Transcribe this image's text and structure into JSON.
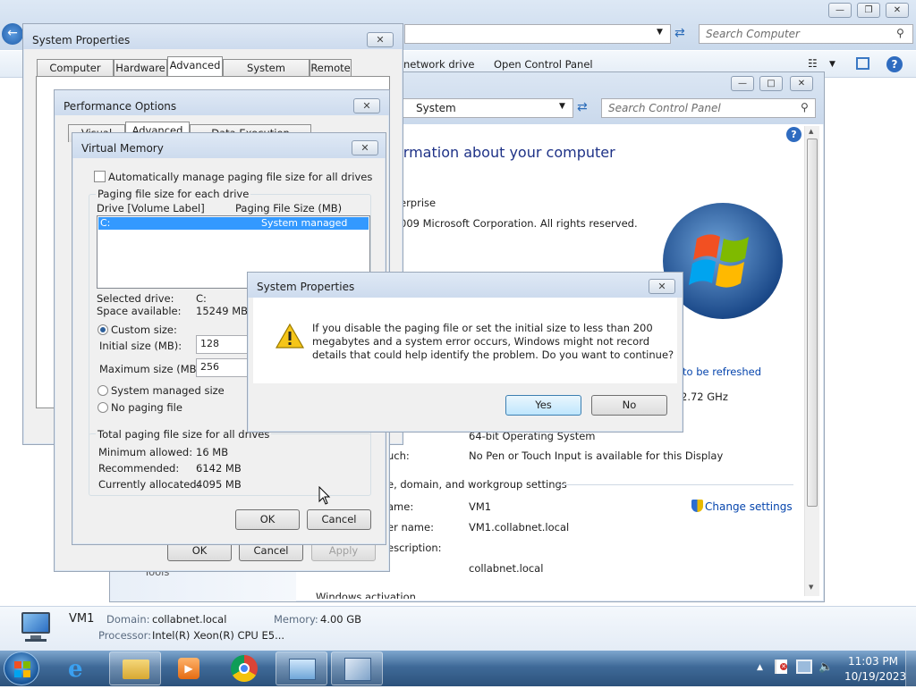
{
  "explorer": {
    "search_placeholder": "Search Computer",
    "toolbar_items": [
      "network drive",
      "Open Control Panel"
    ]
  },
  "control_panel": {
    "breadcrumb": "System",
    "search_placeholder": "Search Control Panel",
    "heading": "ormation about your computer",
    "edition_text": "erprise",
    "copyright_text": "009 Microsoft Corporation.  All rights reserved.",
    "refresh_link": "to be refreshed",
    "cpu_speed": "2.72 GHz",
    "system_type": "64-bit Operating System",
    "pen_label": "uch:",
    "pen_value": "No Pen or Touch Input is available for this Display",
    "section_title": "e, domain, and workgroup settings",
    "computer_name_label": "ame:",
    "computer_name_value": "VM1",
    "full_name_label": "er name:",
    "full_name_value": "VM1.collabnet.local",
    "description_label": "escription:",
    "domain_value": "collabnet.local",
    "change_settings": "Change settings",
    "activation_partial": "Windows activation",
    "tools_partial": "Tools"
  },
  "sysprops_back": {
    "title": "System Properties",
    "tabs": [
      "Computer Name",
      "Hardware",
      "Advanced",
      "System Protection",
      "Remote"
    ],
    "selected_tab": "Advanced",
    "ok": "OK",
    "cancel": "Cancel",
    "apply": "Apply"
  },
  "perf_options": {
    "title": "Performance Options",
    "tabs": [
      "Visual Effects",
      "Advanced",
      "Data Execution Prevention"
    ]
  },
  "virtual_memory": {
    "title": "Virtual Memory",
    "auto_manage_label": "Automatically manage paging file size for all drives",
    "paging_group_label": "Paging file size for each drive",
    "col_drive": "Drive  [Volume Label]",
    "col_size": "Paging File Size (MB)",
    "drive_row": {
      "drive": "C:",
      "size": "System managed"
    },
    "selected_drive_label": "Selected drive:",
    "selected_drive_value": "C:",
    "space_label": "Space available:",
    "space_value": "15249 MB",
    "custom_size_label": "Custom size:",
    "initial_label": "Initial size (MB):",
    "initial_value": "128",
    "max_label": "Maximum size (MB):",
    "max_value": "256",
    "system_managed_label": "System managed size",
    "no_paging_label": "No paging file",
    "total_group_label": "Total paging file size for all drives",
    "min_label": "Minimum allowed:",
    "min_value": "16 MB",
    "rec_label": "Recommended:",
    "rec_value": "6142 MB",
    "alloc_label": "Currently allocated:",
    "alloc_value": "4095 MB",
    "ok": "OK",
    "cancel": "Cancel"
  },
  "alert": {
    "title": "System Properties",
    "line1": "If you disable the paging file or set the initial size to less than 200",
    "line2": "megabytes and a system error occurs, Windows might not record",
    "line3": "details that could help identify the problem. Do you want to continue?",
    "yes": "Yes",
    "no": "No"
  },
  "details_pane": {
    "name": "VM1",
    "domain_label": "Domain:",
    "domain_value": "collabnet.local",
    "memory_label": "Memory:",
    "memory_value": "4.00 GB",
    "processor_label": "Processor:",
    "processor_value": "Intel(R) Xeon(R) CPU E5..."
  },
  "taskbar": {
    "time": "11:03 PM",
    "date": "10/19/2023"
  }
}
